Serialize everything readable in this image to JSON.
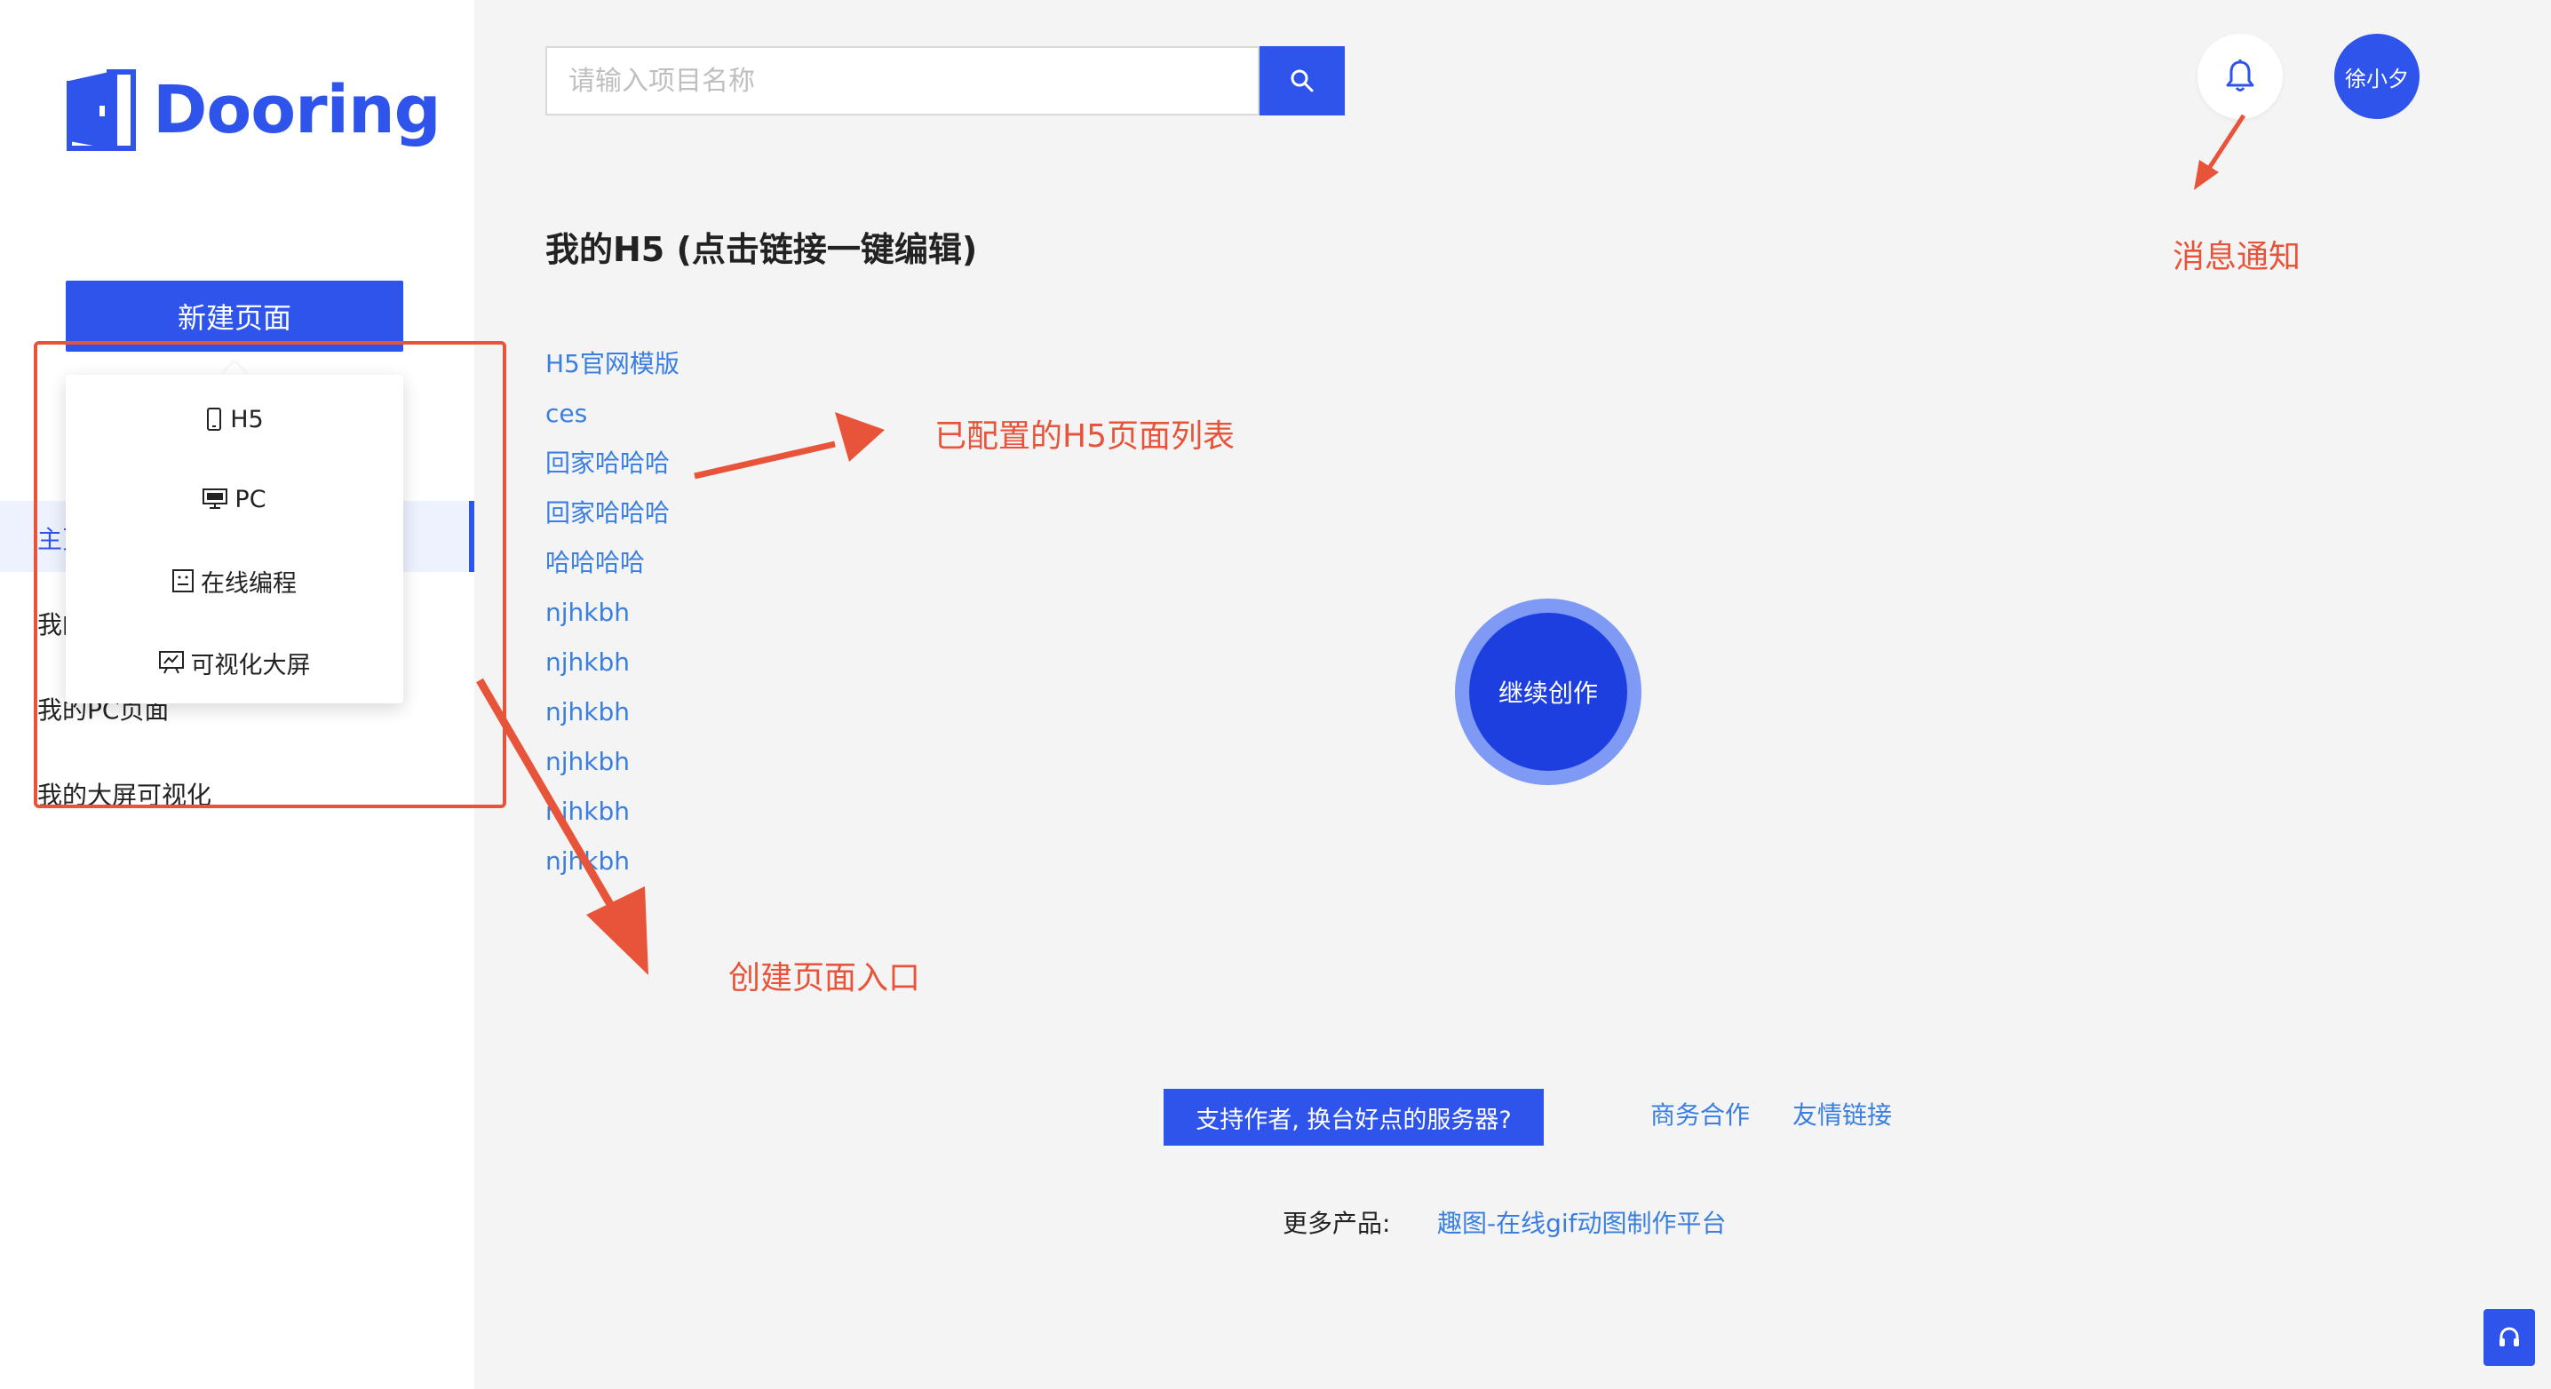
{
  "sidebar": {
    "logo_text": "Dooring",
    "new_page_label": "新建页面",
    "menu_items": [
      {
        "label": "主页"
      },
      {
        "label": "我的H5页面"
      },
      {
        "label": "我的PC页面"
      },
      {
        "label": "我的大屏可视化"
      }
    ],
    "dropdown": [
      {
        "label": "H5",
        "icon": "mobile-icon"
      },
      {
        "label": "PC",
        "icon": "desktop-icon"
      },
      {
        "label": "在线编程",
        "icon": "code-icon"
      },
      {
        "label": "可视化大屏",
        "icon": "dashboard-icon"
      }
    ]
  },
  "header": {
    "search_placeholder": "请输入项目名称",
    "search_icon": "search-icon",
    "bell_icon": "bell-icon",
    "user_name": "徐小夕"
  },
  "main": {
    "title": "我的H5 (点击链接一键编辑)",
    "pages": [
      "H5官网模版",
      "ces",
      "回家哈哈哈",
      "回家哈哈哈",
      "哈哈哈哈",
      "njhkbh",
      "njhkbh",
      "njhkbh",
      "njhkbh",
      "njhkbh",
      "njhkbh"
    ],
    "continue_label": "继续创作"
  },
  "footer": {
    "support_label": "支持作者, 换台好点的服务器?",
    "business_label": "商务合作",
    "friend_links_label": "友情链接",
    "more_products_label": "更多产品:",
    "product_link": "趣图-在线gif动图制作平台"
  },
  "annotations": {
    "notification": "消息通知",
    "page_list": "已配置的H5页面列表",
    "create_entry": "创建页面入口"
  },
  "colors": {
    "primary": "#2f54eb",
    "link": "#3a7fe0",
    "annotation": "#e8543a",
    "background": "#f4f4f4"
  }
}
